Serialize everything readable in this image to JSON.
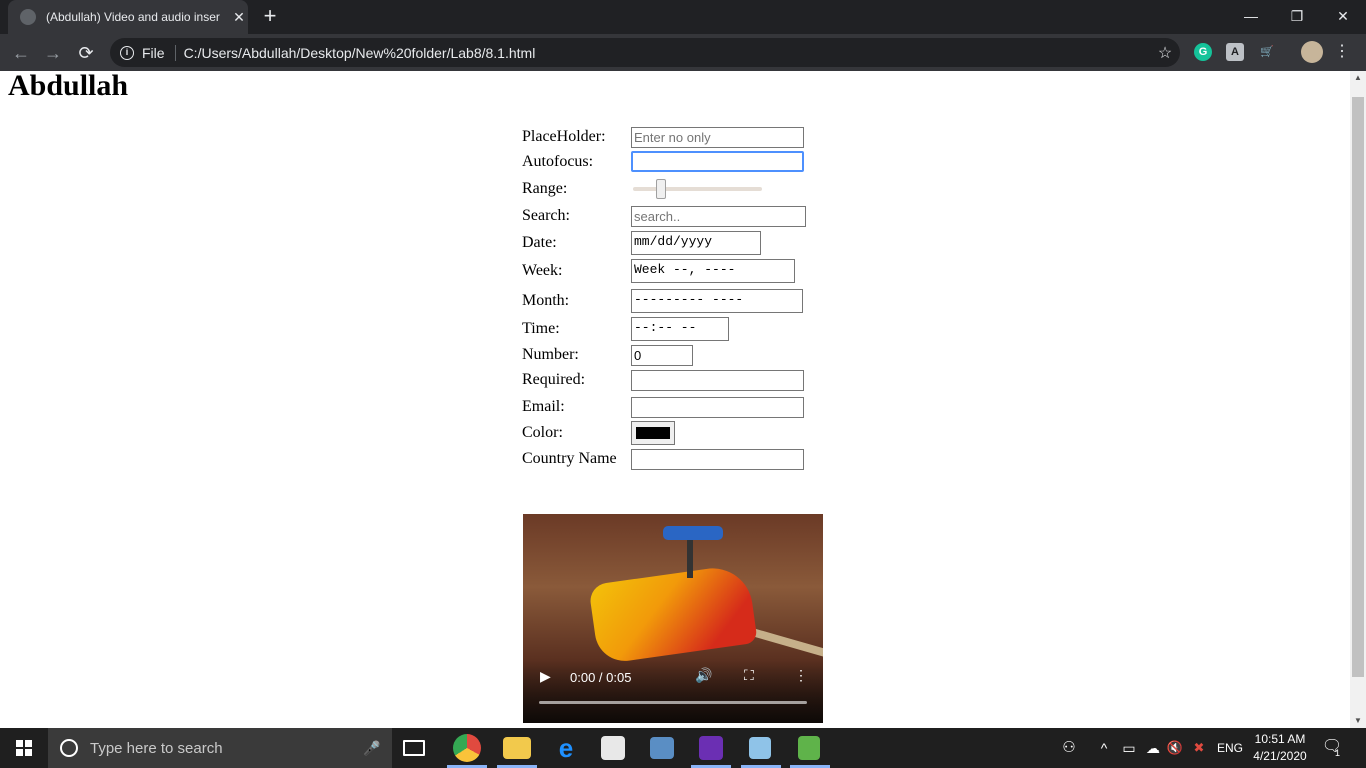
{
  "browser": {
    "tab_title": "(Abdullah) Video and audio inser",
    "tab_close": "✕",
    "new_tab": "+",
    "window_minimize": "—",
    "window_restore": "❐",
    "window_close": "✕",
    "back": "←",
    "forward": "→",
    "reload": "⟳",
    "info": "i",
    "scheme_label": "File",
    "url": "C:/Users/Abdullah/Desktop/New%20folder/Lab8/8.1.html",
    "bookmark_star": "☆",
    "extensions": [
      {
        "icon": "grammarly-icon",
        "glyph": "G",
        "color": "#15c39a"
      },
      {
        "icon": "translate-icon",
        "glyph": "A",
        "color": "#bdc1c6"
      },
      {
        "icon": "cart-icon",
        "glyph": "🛒",
        "color": "#5f6368"
      }
    ],
    "menu": "⋮"
  },
  "page": {
    "heading": "Abdullah",
    "form": {
      "placeholder_label": "PlaceHolder:",
      "placeholder_hint": "Enter no only",
      "autofocus_label": "Autofocus:",
      "range_label": "Range:",
      "range_value": 0.2,
      "search_label": "Search:",
      "search_hint": "search..",
      "date_label": "Date:",
      "date_value": "mm/dd/yyyy",
      "week_label": "Week:",
      "week_value": "Week --, ----",
      "month_label": "Month:",
      "month_value": "--------- ----",
      "time_label": "Time:",
      "time_value": "--:-- --",
      "number_label": "Number:",
      "number_value": "0",
      "required_label": "Required:",
      "email_label": "Email:",
      "color_label": "Color:",
      "color_value": "#000000",
      "country_label": "Country Name"
    },
    "video": {
      "play": "▶",
      "time": "0:00 / 0:05",
      "volume": "🔊",
      "fullscreen": "⛶",
      "more": "⋮",
      "progress": 0
    }
  },
  "scrollbar": {
    "up": "▲",
    "down": "▼"
  },
  "taskbar": {
    "search_placeholder": "Type here to search",
    "mic": "🎤",
    "apps": [
      {
        "icon": "task-view-icon",
        "color": "#1f1f1f"
      },
      {
        "icon": "chrome-icon",
        "color": "#e04a3f"
      },
      {
        "icon": "file-explorer-icon",
        "color": "#f2c94c"
      },
      {
        "icon": "edge-icon",
        "color": "#1e90ff"
      },
      {
        "icon": "store-icon",
        "color": "#e8e8e8"
      },
      {
        "icon": "network-app-icon",
        "color": "#5a8ec4"
      },
      {
        "icon": "visual-studio-icon",
        "color": "#6b2fb3"
      },
      {
        "icon": "paint-app-icon",
        "color": "#8fc3e8"
      },
      {
        "icon": "notepad-chart-icon",
        "color": "#5fb34a"
      }
    ],
    "tray": {
      "people": "⚇",
      "chevron": "^",
      "battery": "▭",
      "network": "☁",
      "volume": "🔇",
      "language": "ENG"
    },
    "time": "10:51 AM",
    "date": "4/21/2020",
    "notifications": "🗨",
    "notification_count": "1"
  }
}
